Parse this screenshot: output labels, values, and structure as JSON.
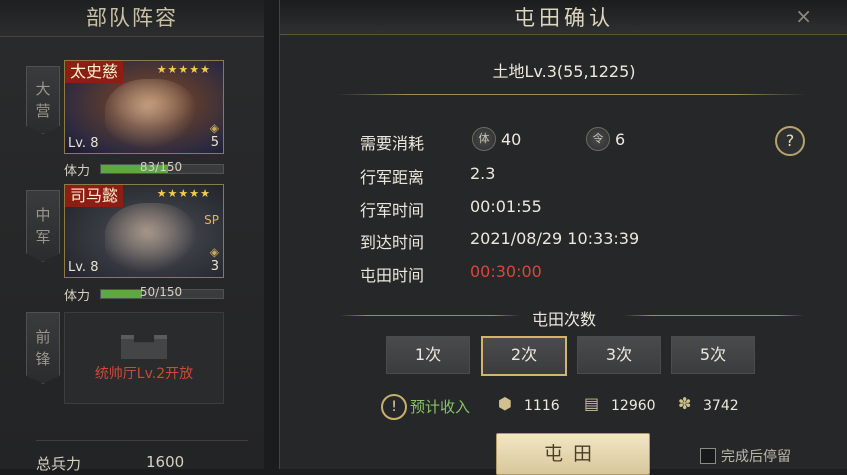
{
  "left_panel": {
    "title": "部队阵容",
    "slots": [
      {
        "tag": [
          "大",
          "营"
        ]
      },
      {
        "tag": [
          "中",
          "军"
        ]
      },
      {
        "tag": [
          "前",
          "锋"
        ]
      }
    ],
    "heroes": [
      {
        "name": "太史慈",
        "stars": "★★★★★",
        "level": "Lv. 8",
        "badge": "5",
        "stamina_label": "体力",
        "stamina_text": "83/150",
        "stamina_fraction": 0.553
      },
      {
        "name": "司马懿",
        "stars": "★★★★★",
        "level": "Lv. 8",
        "badge_top": "SP",
        "badge": "3",
        "stamina_label": "体力",
        "stamina_text": "50/150",
        "stamina_fraction": 0.333
      }
    ],
    "locked_slot_text": "统帅厅Lv.2开放",
    "troops_label": "总兵力",
    "troops_value": "1600"
  },
  "dialog": {
    "title": "屯田确认",
    "close_icon": "×",
    "land": "土地Lv.3(55,1225)",
    "cost_label": "需要消耗",
    "cost_stamina_icon": "体",
    "cost_stamina_value": "40",
    "cost_order_icon": "令",
    "cost_order_value": "6",
    "help": "?",
    "distance_label": "行军距离",
    "distance_value": "2.3",
    "march_time_label": "行军时间",
    "march_time_value": "00:01:55",
    "arrive_label": "到达时间",
    "arrive_value": "2021/08/29 10:33:39",
    "farm_time_label": "屯田时间",
    "farm_time_value": "00:30:00",
    "count_title": "屯田次数",
    "count_options": [
      "1次",
      "2次",
      "3次",
      "5次"
    ],
    "selected_count": "2次",
    "income_icon": "!",
    "income_label": "预计收入",
    "resources": [
      {
        "icon": "stone-icon",
        "value": "1116"
      },
      {
        "icon": "wood-icon",
        "value": "12960"
      },
      {
        "icon": "grain-icon",
        "value": "3742"
      }
    ],
    "confirm_label": "屯田",
    "stay_label": "完成后停留"
  },
  "colors": {
    "accent_gold": "#d3b46a",
    "alert_red": "#d8463a",
    "income_green": "#86c26a",
    "hero_name_bg": "#8e1d14"
  }
}
